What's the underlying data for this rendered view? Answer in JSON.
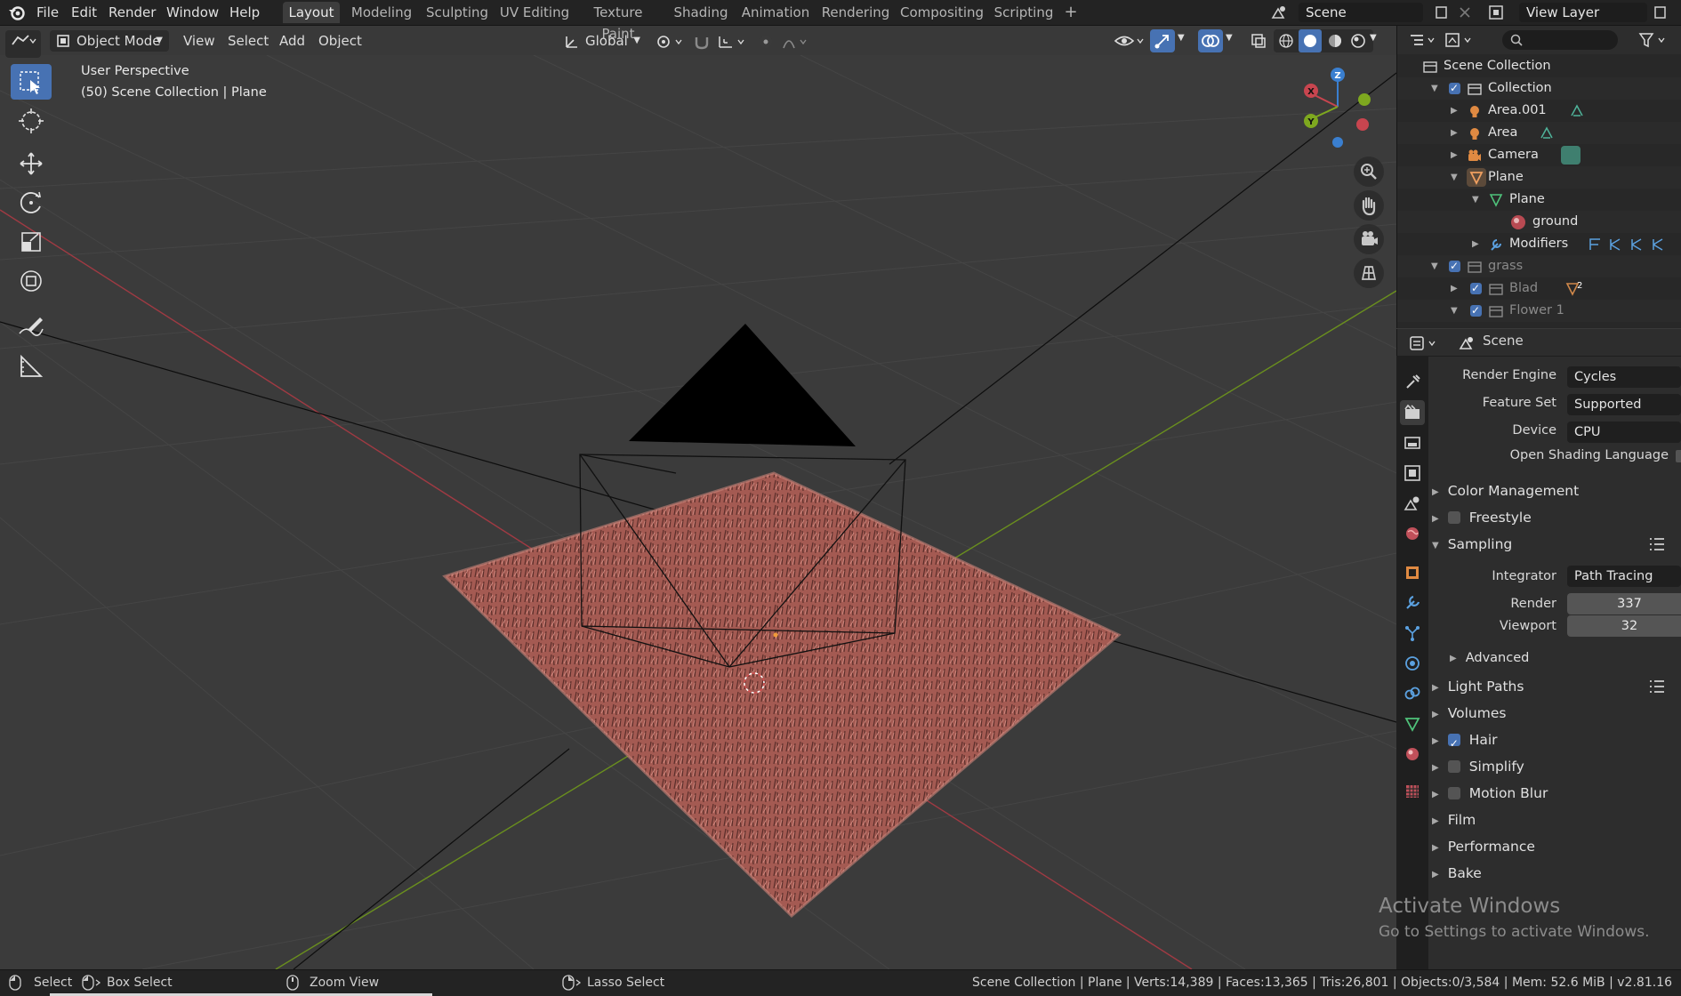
{
  "topbar": {
    "menu": [
      "File",
      "Edit",
      "Render",
      "Window",
      "Help"
    ],
    "workspaces": [
      "Layout",
      "Modeling",
      "Sculpting",
      "UV Editing",
      "Texture Paint",
      "Shading",
      "Animation",
      "Rendering",
      "Compositing",
      "Scripting"
    ],
    "active_workspace": "Layout",
    "add_workspace": "+",
    "scene": "Scene",
    "view_layer": "View Layer"
  },
  "viewport_header": {
    "mode": "Object Mode",
    "menus": [
      "View",
      "Select",
      "Add",
      "Object"
    ],
    "orientation": "Global"
  },
  "viewport": {
    "view_name": "User Perspective",
    "collection_info": "(50) Scene Collection | Plane",
    "gizmo_axes": {
      "x": "X",
      "y": "Y",
      "z": "Z"
    }
  },
  "outliner": {
    "rows": [
      {
        "label": "Scene Collection",
        "icon": "scene-collection-icon"
      },
      {
        "label": "Collection",
        "icon": "collection-icon"
      },
      {
        "label": "Area.001",
        "icon": "light-icon"
      },
      {
        "label": "Area",
        "icon": "light-icon"
      },
      {
        "label": "Camera",
        "icon": "camera-icon"
      },
      {
        "label": "Plane",
        "icon": "mesh-object-icon"
      },
      {
        "label": "Plane",
        "icon": "mesh-data-icon"
      },
      {
        "label": "ground",
        "icon": "material-icon"
      },
      {
        "label": "Modifiers",
        "icon": "wrench-icon"
      },
      {
        "label": "grass",
        "icon": "collection-icon"
      },
      {
        "label": "Blad",
        "icon": "collection-icon"
      },
      {
        "label": "Flower 1",
        "icon": "collection-icon"
      }
    ],
    "blad_user_count": "2"
  },
  "properties": {
    "context": "Scene",
    "render_engine": {
      "label": "Render Engine",
      "value": "Cycles"
    },
    "feature_set": {
      "label": "Feature Set",
      "value": "Supported"
    },
    "device": {
      "label": "Device",
      "value": "CPU"
    },
    "osl": "Open Shading Language",
    "sections": {
      "color_management": "Color Management",
      "freestyle": "Freestyle",
      "sampling": "Sampling",
      "light_paths": "Light Paths",
      "volumes": "Volumes",
      "hair": "Hair",
      "simplify": "Simplify",
      "motion_blur": "Motion Blur",
      "film": "Film",
      "performance": "Performance",
      "bake": "Bake"
    },
    "integrator": {
      "label": "Integrator",
      "value": "Path Tracing"
    },
    "render_samples": {
      "label": "Render",
      "value": "337"
    },
    "viewport_samples": {
      "label": "Viewport",
      "value": "32"
    },
    "advanced": "Advanced",
    "checkboxes": {
      "freestyle": false,
      "hair": true,
      "simplify": false,
      "motion_blur": false
    }
  },
  "statusbar": {
    "select": "Select",
    "box_select": "Box Select",
    "zoom_view": "Zoom View",
    "lasso_select": "Lasso Select",
    "stats": "Scene Collection | Plane | Verts:14,389 | Faces:13,365 | Tris:26,801 | Objects:0/3,584 | Mem: 52.6 MiB | v2.81.16"
  },
  "watermark": {
    "line1": "Activate Windows",
    "line2": "Go to Settings to activate Windows."
  },
  "colors": {
    "accent": "#4772b3",
    "grass": "#a45a52",
    "x_axis": "#c8454f",
    "y_axis": "#7ea81f",
    "z_axis": "#3a7fd0"
  }
}
